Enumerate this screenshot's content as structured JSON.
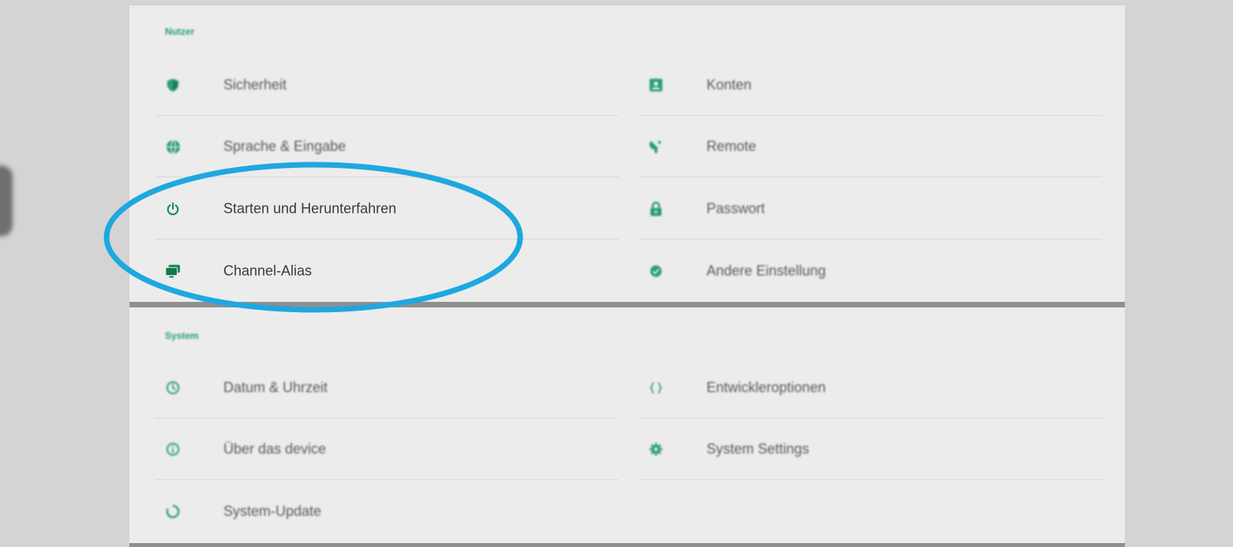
{
  "sections": {
    "user": {
      "title": "Nutzer",
      "left": [
        {
          "label": "Sicherheit",
          "icon": "shield-icon"
        },
        {
          "label": "Sprache & Eingabe",
          "icon": "globe-icon"
        },
        {
          "label": "Starten und Herunterfahren",
          "icon": "power-icon"
        },
        {
          "label": "Channel-Alias",
          "icon": "screens-icon"
        }
      ],
      "right": [
        {
          "label": "Konten",
          "icon": "account-icon"
        },
        {
          "label": "Remote",
          "icon": "satellite-icon"
        },
        {
          "label": "Passwort",
          "icon": "lock-icon"
        },
        {
          "label": "Andere Einstellung",
          "icon": "check-circle-icon"
        }
      ]
    },
    "system": {
      "title": "System",
      "left": [
        {
          "label": "Datum & Uhrzeit",
          "icon": "clock-icon"
        },
        {
          "label": "Über das device",
          "icon": "info-icon"
        },
        {
          "label": "System-Update",
          "icon": "update-icon"
        }
      ],
      "right": [
        {
          "label": "Entwickleroptionen",
          "icon": "braces-icon"
        },
        {
          "label": "System Settings",
          "icon": "gear-icon"
        }
      ]
    }
  },
  "colors": {
    "accent": "#2a9d78",
    "annotation": "#1ea8e0",
    "panel": "#ececec",
    "background": "#d4d4d4"
  }
}
